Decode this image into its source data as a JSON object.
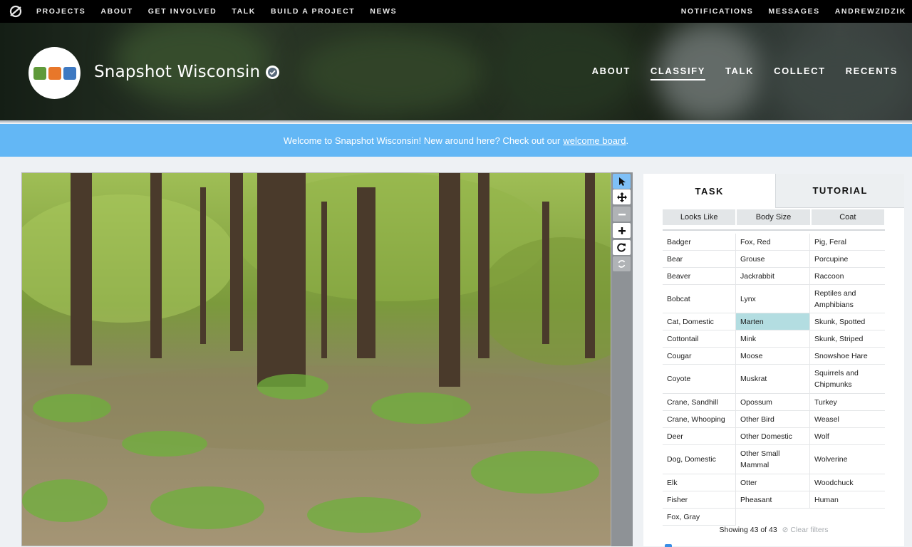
{
  "topbar": {
    "left": [
      "PROJECTS",
      "ABOUT",
      "GET INVOLVED",
      "TALK",
      "BUILD A PROJECT",
      "NEWS"
    ],
    "right": [
      "NOTIFICATIONS",
      "MESSAGES",
      "ANDREWZIDZIK"
    ]
  },
  "project": {
    "title": "Snapshot Wisconsin",
    "nav": [
      "ABOUT",
      "CLASSIFY",
      "TALK",
      "COLLECT",
      "RECENTS"
    ],
    "active_nav": "CLASSIFY"
  },
  "announcement": {
    "text": "Welcome to Snapshot Wisconsin! New around here? Check out our",
    "link": "welcome board",
    "suffix": "."
  },
  "toolbar_icons": [
    "pointer-icon",
    "move-icon",
    "zoom-out-icon",
    "zoom-in-icon",
    "rotate-icon",
    "reset-icon"
  ],
  "panel": {
    "tabs": [
      "TASK",
      "TUTORIAL"
    ],
    "filters": [
      "Looks Like",
      "Body Size",
      "Coat"
    ],
    "choices": [
      [
        "Badger",
        "Fox, Red",
        "Pig, Feral"
      ],
      [
        "Bear",
        "Grouse",
        "Porcupine"
      ],
      [
        "Beaver",
        "Jackrabbit",
        "Raccoon"
      ],
      [
        "Bobcat",
        "Lynx",
        "Reptiles and Amphibians"
      ],
      [
        "Cat, Domestic",
        "Marten",
        "Skunk, Spotted"
      ],
      [
        "Cottontail",
        "Mink",
        "Skunk, Striped"
      ],
      [
        "Cougar",
        "Moose",
        "Snowshoe Hare"
      ],
      [
        "Coyote",
        "Muskrat",
        "Squirrels and Chipmunks"
      ],
      [
        "Crane, Sandhill",
        "Opossum",
        "Turkey"
      ],
      [
        "Crane, Whooping",
        "Other Bird",
        "Weasel"
      ],
      [
        "Deer",
        "Other Domestic",
        "Wolf"
      ],
      [
        "Dog, Domestic",
        "Other Small Mammal",
        "Wolverine"
      ],
      [
        "Elk",
        "Otter",
        "Woodchuck"
      ],
      [
        "Fisher",
        "Pheasant",
        "Human"
      ],
      [
        "Fox, Gray",
        "",
        ""
      ]
    ],
    "highlighted": "Marten",
    "status": "Showing 43 of 43",
    "clear": "Clear filters"
  },
  "colors": {
    "announce": "#63b7f5",
    "highlight": "#b3dde1",
    "tool_selected": "#7fc0f7"
  }
}
